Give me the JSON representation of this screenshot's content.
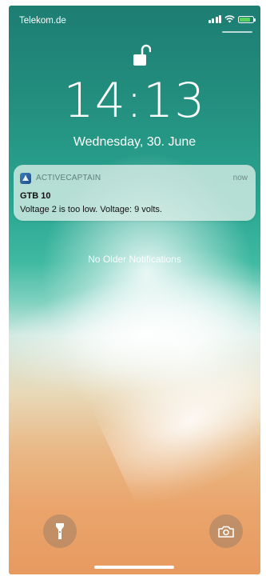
{
  "status_bar": {
    "carrier": "Telekom.de",
    "battery_color": "#5ad05f",
    "icons": [
      "signal-icon",
      "wifi-icon",
      "battery-charging-icon"
    ]
  },
  "lock_screen": {
    "lock_icon": "unlocked-padlock-icon",
    "time": "14:13",
    "date": "Wednesday, 30. June"
  },
  "notification": {
    "app_icon": "activecaptain-app-icon",
    "app_name": "ACTIVECAPTAIN",
    "time": "now",
    "title": "GTB 10",
    "body": "Voltage 2 is too low. Voltage: 9 volts."
  },
  "no_older": "No Older Notifications",
  "controls": {
    "flashlight_icon": "flashlight-icon",
    "camera_icon": "camera-icon"
  }
}
